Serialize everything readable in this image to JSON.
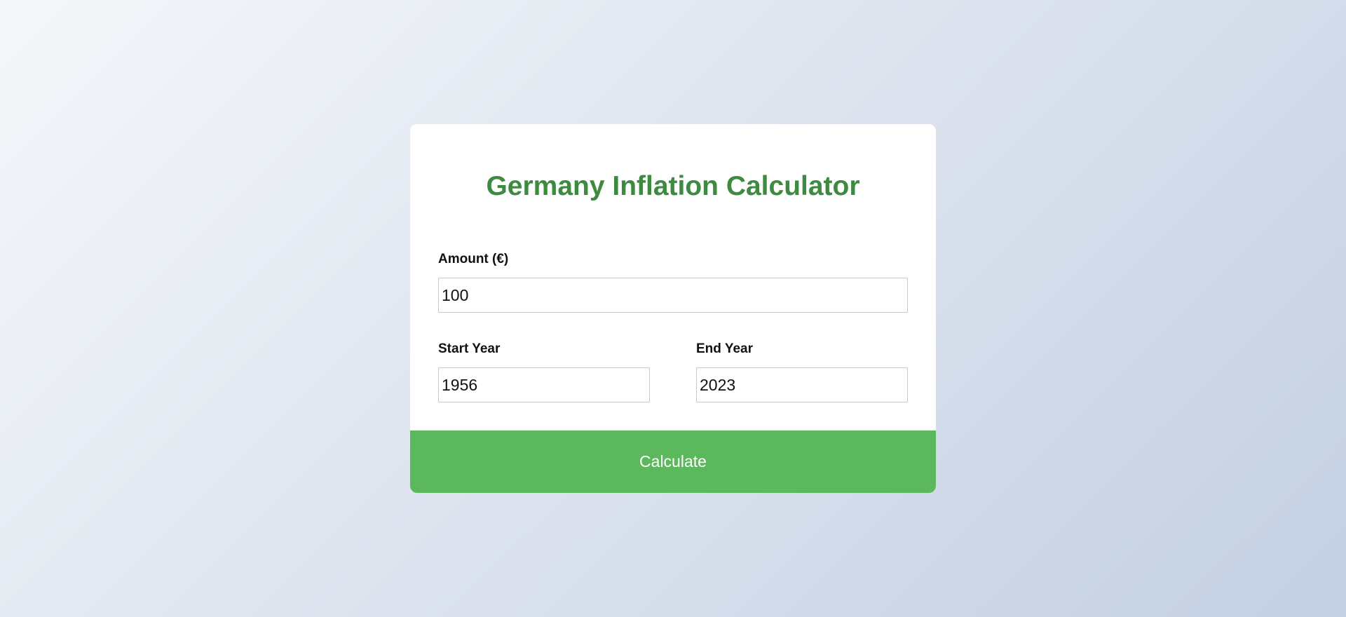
{
  "calculator": {
    "title": "Germany Inflation Calculator",
    "amount": {
      "label": "Amount (€)",
      "value": "100"
    },
    "start_year": {
      "label": "Start Year",
      "value": "1956"
    },
    "end_year": {
      "label": "End Year",
      "value": "2023"
    },
    "button_label": "Calculate"
  },
  "colors": {
    "title": "#3e8a41",
    "button": "#5cb85c",
    "background_start": "#f5f7fa",
    "background_end": "#c3cfe2"
  }
}
